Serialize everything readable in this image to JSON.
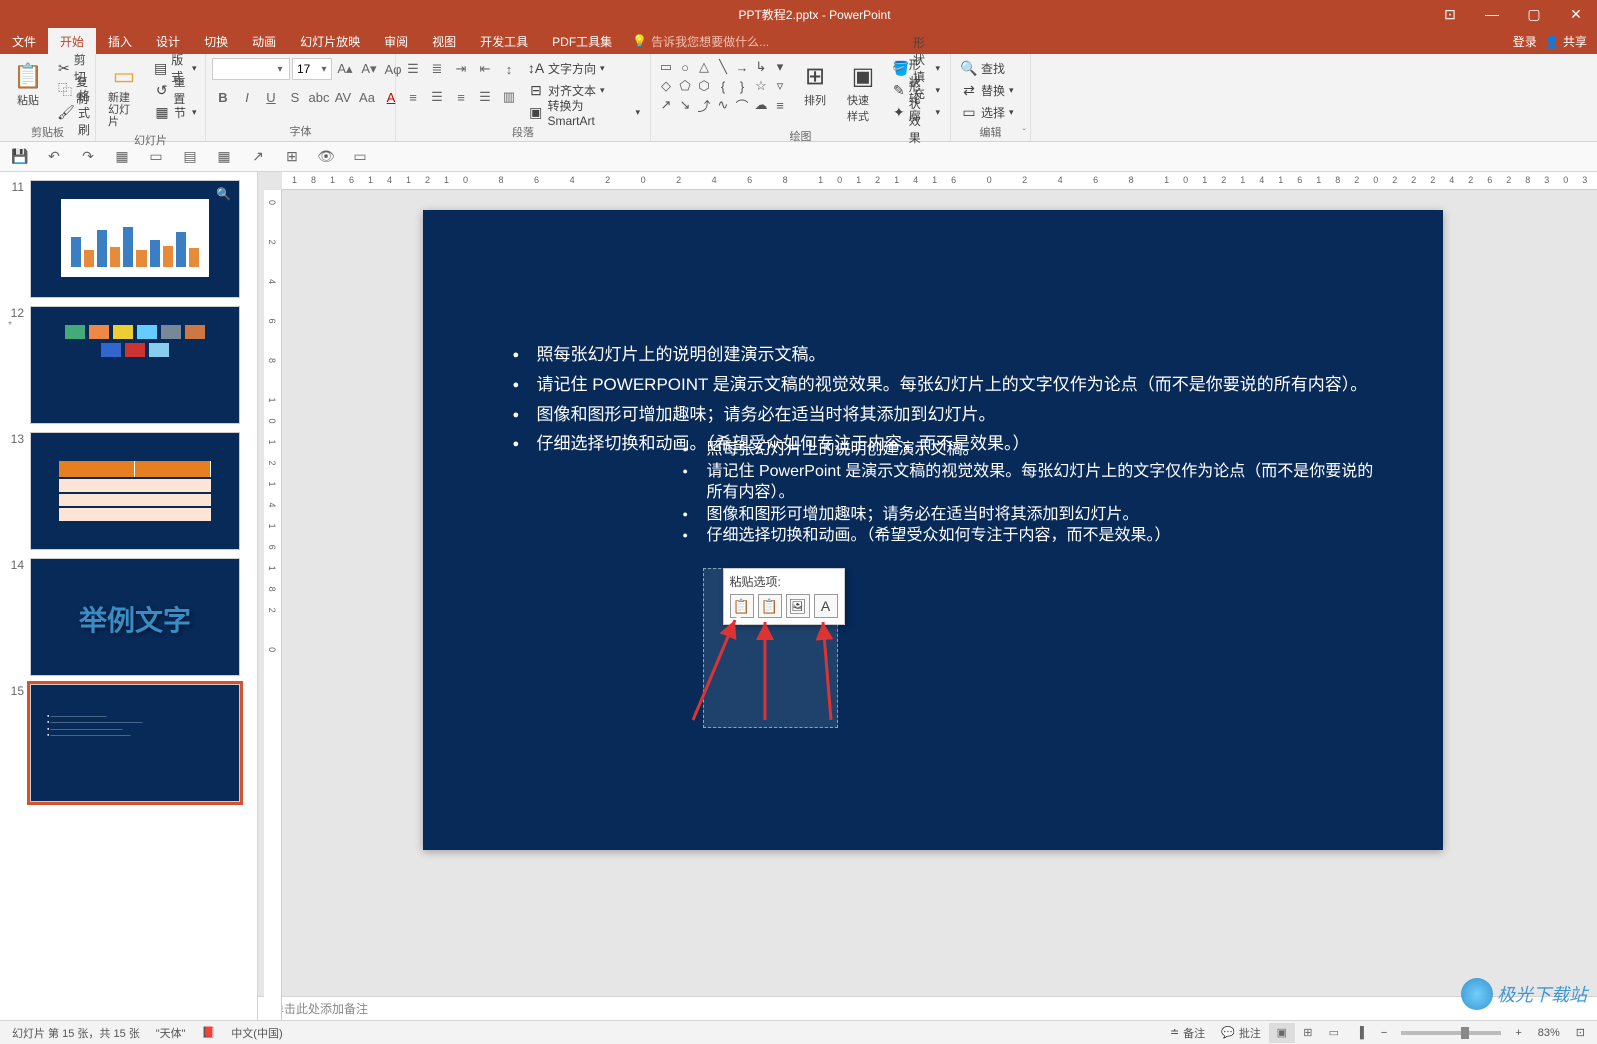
{
  "title": "PPT教程2.pptx - PowerPoint",
  "window_controls": {
    "displayopts": "⊡",
    "min": "—",
    "max": "▢",
    "close": "✕"
  },
  "tabs": {
    "file": "文件",
    "home": "开始",
    "insert": "插入",
    "design": "设计",
    "transitions": "切换",
    "animations": "动画",
    "slideshow": "幻灯片放映",
    "review": "审阅",
    "view": "视图",
    "developer": "开发工具",
    "pdf": "PDF工具集",
    "tell_me": "告诉我您想要做什么...",
    "login": "登录",
    "share": "共享"
  },
  "ribbon": {
    "clipboard": {
      "paste": "粘贴",
      "cut": "剪切",
      "copy": "复制",
      "format_painter": "格式刷",
      "label": "剪贴板"
    },
    "slides": {
      "new_slide": "新建\n幻灯片",
      "layout": "版式",
      "reset": "重置",
      "section": "节",
      "label": "幻灯片"
    },
    "font": {
      "name": "",
      "size": "17",
      "label": "字体"
    },
    "paragraph": {
      "text_direction": "文字方向",
      "align_text": "对齐文本",
      "smartart": "转换为 SmartArt",
      "label": "段落"
    },
    "drawing": {
      "arrange": "排列",
      "quick_styles": "快速样式",
      "shape_fill": "形状填充",
      "shape_outline": "形状轮廓",
      "shape_effects": "形状效果",
      "label": "绘图"
    },
    "editing": {
      "find": "查找",
      "replace": "替换",
      "select": "选择",
      "label": "编辑"
    }
  },
  "thumbs": {
    "n11": "11",
    "n12": "12",
    "n13": "13",
    "n14": "14",
    "n15": "15",
    "text_example": "举例文字"
  },
  "slide": {
    "b1": "照每张幻灯片上的说明创建演示文稿。",
    "b2": "请记住 POWERPOINT 是演示文稿的视觉效果。每张幻灯片上的文字仅作为论点（而不是你要说的所有内容）。",
    "b3": "图像和图形可增加趣味；请务必在适当时将其添加到幻灯片。",
    "b4": "仔细选择切换和动画。（希望受众如何专注于内容，而不是效果。）",
    "s1": "照每张幻灯片上的说明创建演示文稿。",
    "s2": "请记住 PowerPoint 是演示文稿的视觉效果。每张幻灯片上的文字仅作为论点（而不是你要说的所有内容）。",
    "s3": "图像和图形可增加趣味；请务必在适当时将其添加到幻灯片。",
    "s4": "仔细选择切换和动画。（希望受众如何专注于内容，而不是效果。）"
  },
  "paste_options": {
    "title": "粘贴选项:"
  },
  "notes_placeholder": "单击此处添加备注",
  "status": {
    "slide_count": "幻灯片 第 15 张，共 15 张",
    "language1": "\"天体\"",
    "language2": "中文(中国)",
    "notes_btn": "备注",
    "comments_btn": "批注",
    "zoom": "83%"
  },
  "watermark": "极光下载站"
}
